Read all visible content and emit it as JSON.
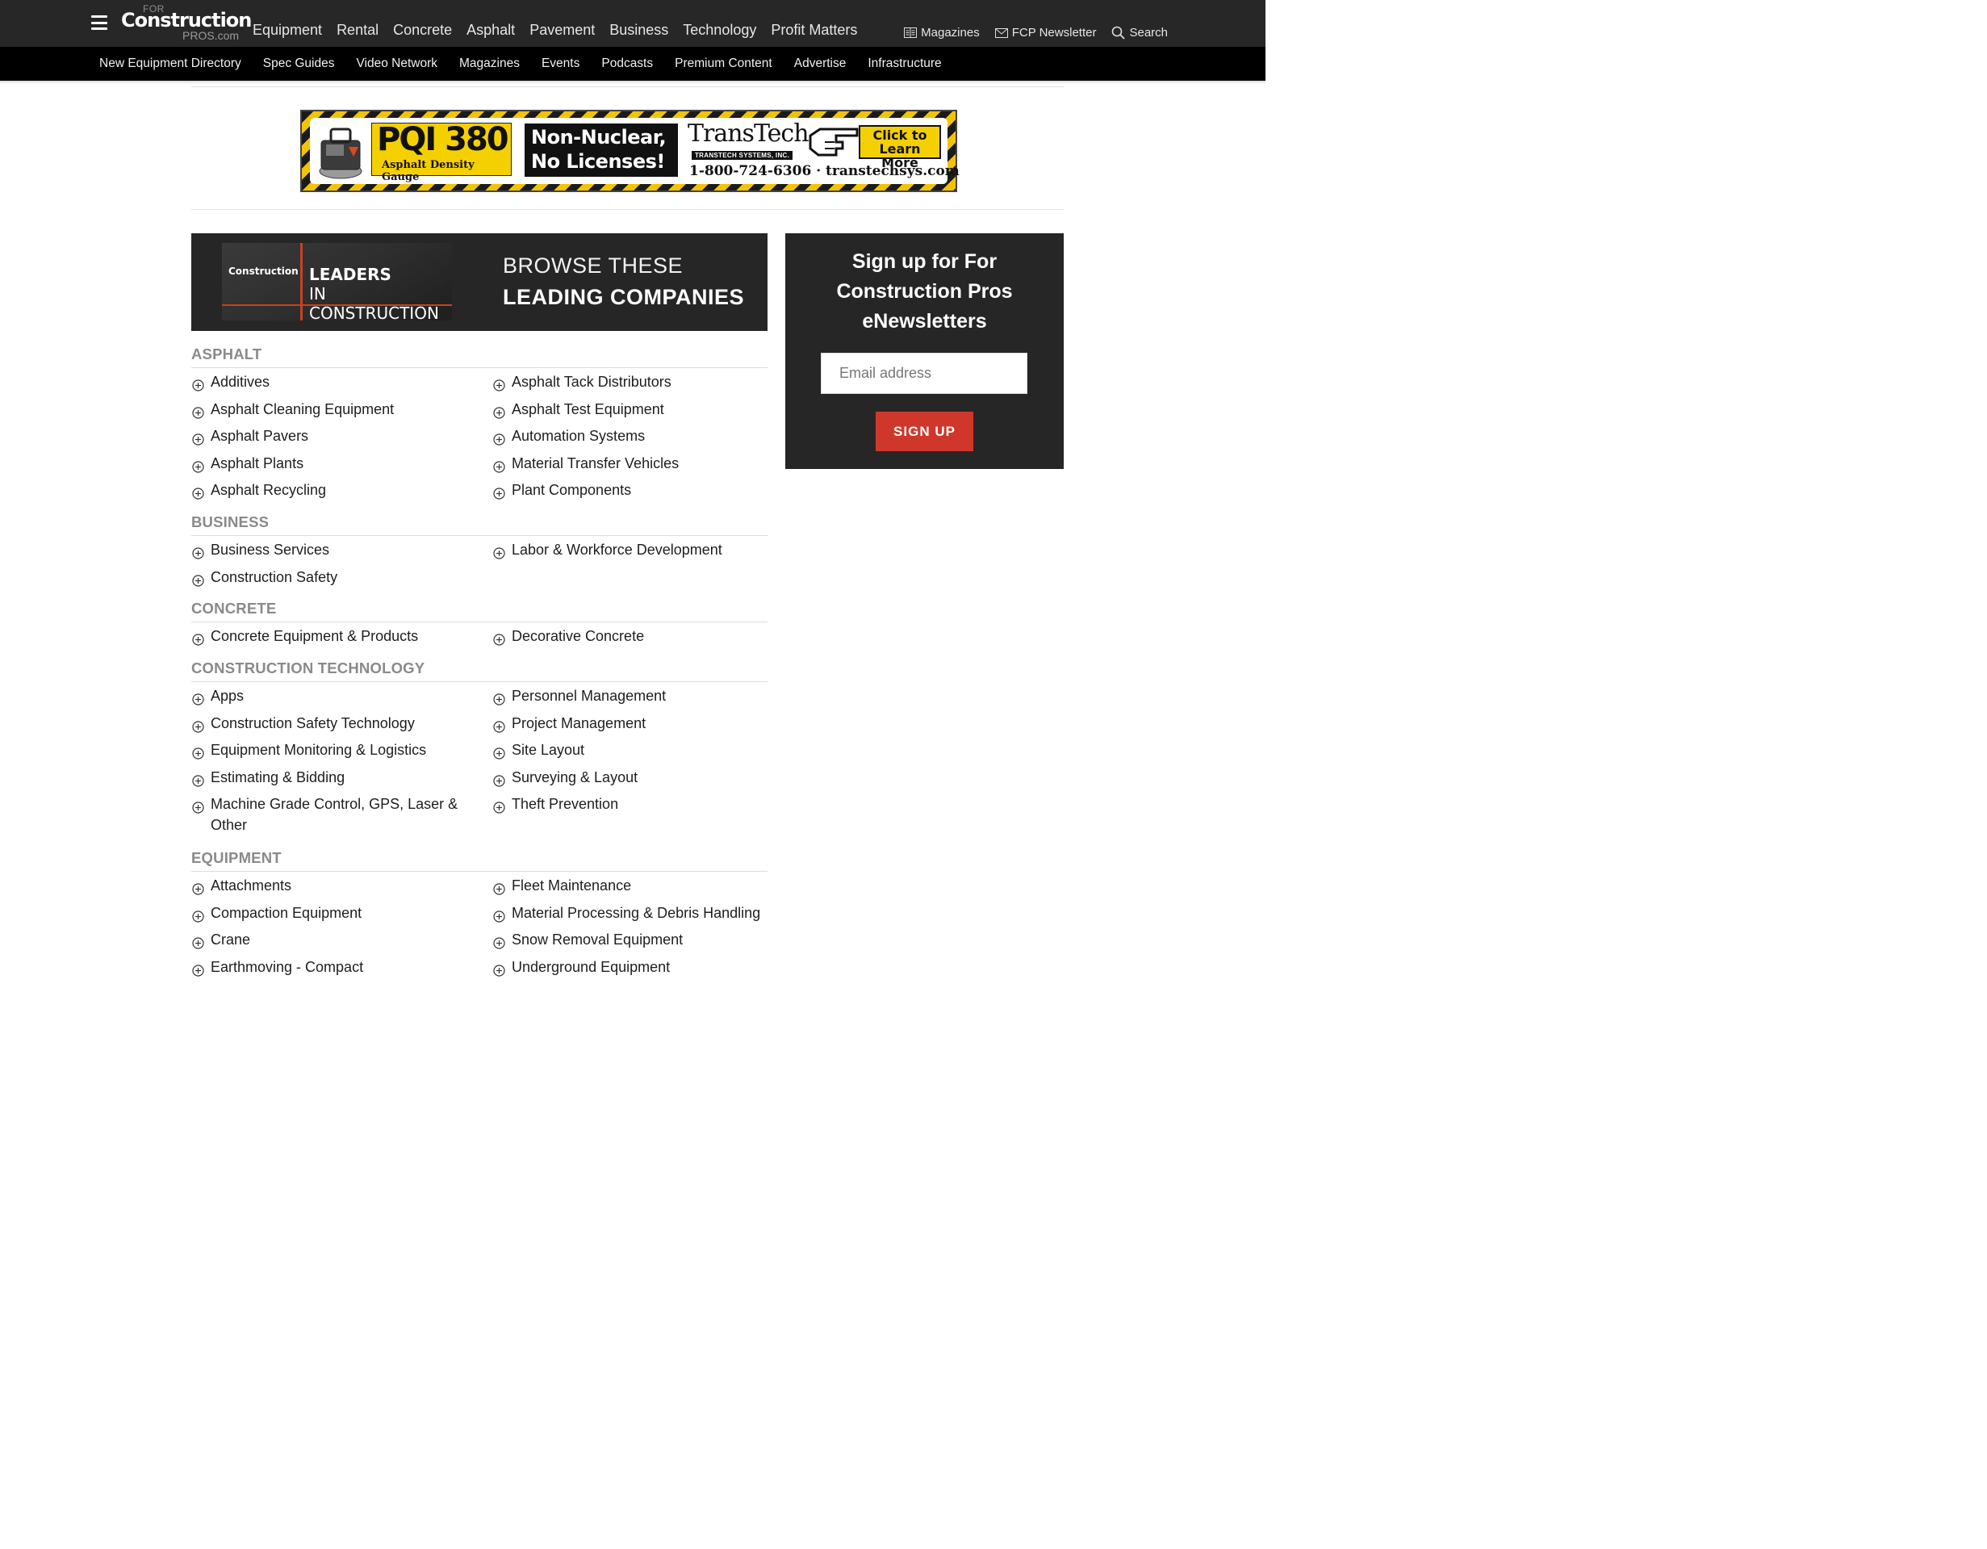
{
  "header": {
    "logo": {
      "for": "FOR",
      "main": "Construction",
      "pros": "PROS.com"
    },
    "main_nav": [
      "Equipment",
      "Rental",
      "Concrete",
      "Asphalt",
      "Pavement",
      "Business",
      "Technology",
      "Profit Matters"
    ],
    "utility": {
      "magazines": "Magazines",
      "newsletter": "FCP Newsletter",
      "search": "Search"
    },
    "sub_nav": [
      "New Equipment Directory",
      "Spec Guides",
      "Video Network",
      "Magazines",
      "Events",
      "Podcasts",
      "Premium Content",
      "Advertise",
      "Infrastructure"
    ]
  },
  "ad": {
    "product": "PQI 380",
    "product_sub": "Asphalt Density Gauge",
    "tagline_1": "Non-Nuclear,",
    "tagline_2": "No Licenses!",
    "brand": "TransTech",
    "brand_sub": "TRANSTECH SYSTEMS, INC.",
    "cta_1": "Click to",
    "cta_2": "Learn More",
    "contact": "1-800-724-6306 · transtechsys.com",
    "colors": {
      "yellow": "#f5d000",
      "black": "#111111"
    }
  },
  "leaders": {
    "thumb_logo": "Construction",
    "thumb_title_1": "LEADERS",
    "thumb_title_2": "IN CONSTRUCTION",
    "browse_line1": "BROWSE THESE",
    "browse_line2": "LEADING COMPANIES"
  },
  "categories": [
    {
      "heading": "ASPHALT",
      "left": [
        "Additives",
        "Asphalt Cleaning Equipment",
        "Asphalt Pavers",
        "Asphalt Plants",
        "Asphalt Recycling"
      ],
      "right": [
        "Asphalt Tack Distributors",
        "Asphalt Test Equipment",
        "Automation Systems",
        "Material Transfer Vehicles",
        "Plant Components"
      ]
    },
    {
      "heading": "BUSINESS",
      "left": [
        "Business Services",
        "Construction Safety"
      ],
      "right": [
        "Labor & Workforce Development"
      ]
    },
    {
      "heading": "CONCRETE",
      "left": [
        "Concrete Equipment & Products"
      ],
      "right": [
        "Decorative Concrete"
      ]
    },
    {
      "heading": "CONSTRUCTION TECHNOLOGY",
      "left": [
        "Apps",
        "Construction Safety Technology",
        "Equipment Monitoring & Logistics",
        "Estimating & Bidding",
        "Machine Grade Control, GPS, Laser & Other"
      ],
      "right": [
        "Personnel Management",
        "Project Management",
        "Site Layout",
        "Surveying & Layout",
        "Theft Prevention"
      ]
    },
    {
      "heading": "EQUIPMENT",
      "left": [
        "Attachments",
        "Compaction Equipment",
        "Crane",
        "Earthmoving - Compact"
      ],
      "right": [
        "Fleet Maintenance",
        "Material Processing & Debris Handling",
        "Snow Removal Equipment",
        "Underground Equipment"
      ]
    }
  ],
  "signup": {
    "title": "Sign up for For Construction Pros eNewsletters",
    "email_placeholder": "Email address",
    "button": "SIGN UP",
    "colors": {
      "panel": "#262626",
      "button": "#d0372b"
    }
  }
}
